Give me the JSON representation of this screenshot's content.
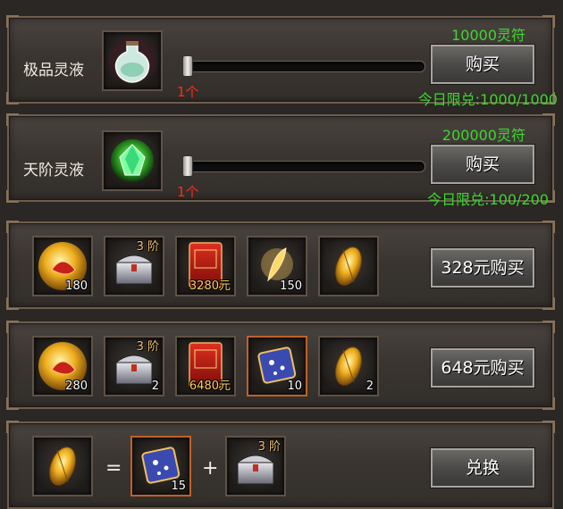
{
  "shop_items": [
    {
      "name": "极品灵液",
      "price": "10000灵符",
      "count": "1个",
      "limit": "今日限兑:1000/1000",
      "buy_label": "购买",
      "slider_fraction": 0
    },
    {
      "name": "天阶灵液",
      "price": "200000灵符",
      "count": "1个",
      "limit": "今日限兑:100/200",
      "buy_label": "购买",
      "slider_fraction": 0
    }
  ],
  "bundles": [
    {
      "button_label": "328元购买",
      "items": [
        {
          "icon": "gold-orb-icon",
          "qty": "180",
          "tier": ""
        },
        {
          "icon": "treasure-chest-icon",
          "qty": "",
          "tier": "3 阶"
        },
        {
          "icon": "recharge-card-icon",
          "qty": "3280元",
          "tier": ""
        },
        {
          "icon": "golden-feather-icon",
          "qty": "150",
          "tier": ""
        },
        {
          "icon": "golden-seed-icon",
          "qty": "",
          "tier": ""
        }
      ]
    },
    {
      "button_label": "648元购买",
      "items": [
        {
          "icon": "gold-orb-icon",
          "qty": "280",
          "tier": ""
        },
        {
          "icon": "treasure-chest-icon",
          "qty": "2",
          "tier": "3 阶"
        },
        {
          "icon": "recharge-card-icon",
          "qty": "6480元",
          "tier": ""
        },
        {
          "icon": "starry-scroll-icon",
          "qty": "10",
          "tier": ""
        },
        {
          "icon": "golden-seed-icon",
          "qty": "2",
          "tier": ""
        }
      ]
    }
  ],
  "exchange": {
    "button_label": "兑换",
    "equals": "=",
    "plus": "+",
    "input": {
      "icon": "golden-seed-icon",
      "qty": ""
    },
    "outputs": [
      {
        "icon": "starry-scroll-icon",
        "qty": "15",
        "tier": ""
      },
      {
        "icon": "treasure-chest-icon",
        "qty": "",
        "tier": "3 阶"
      }
    ]
  }
}
